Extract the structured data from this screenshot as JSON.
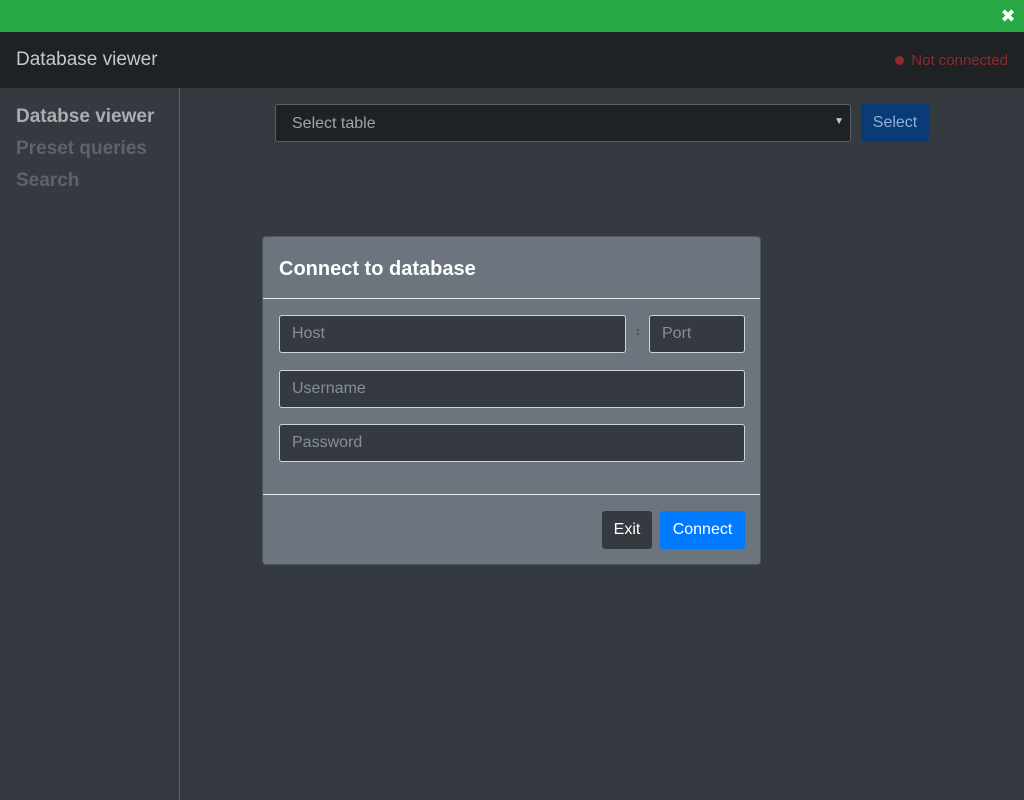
{
  "titlebar": {
    "close_icon": "close-icon"
  },
  "navbar": {
    "title": "Database viewer",
    "status_text": "Not connected",
    "status_color": "#8e2a2a"
  },
  "sidebar": {
    "items": [
      {
        "label": "Databse viewer",
        "active": true
      },
      {
        "label": "Preset queries",
        "active": false
      },
      {
        "label": "Search",
        "active": false
      }
    ]
  },
  "main": {
    "select_placeholder": "Select table",
    "select_button": "Select"
  },
  "modal": {
    "title": "Connect to database",
    "host_placeholder": "Host",
    "port_separator": ":",
    "port_placeholder": "Port",
    "username_placeholder": "Username",
    "password_placeholder": "Password",
    "exit_label": "Exit",
    "connect_label": "Connect"
  },
  "colors": {
    "titlebar": "#28a745",
    "navbar": "#1f2225",
    "background": "#343a40",
    "modal": "#6c757d",
    "primary": "#007bff"
  }
}
